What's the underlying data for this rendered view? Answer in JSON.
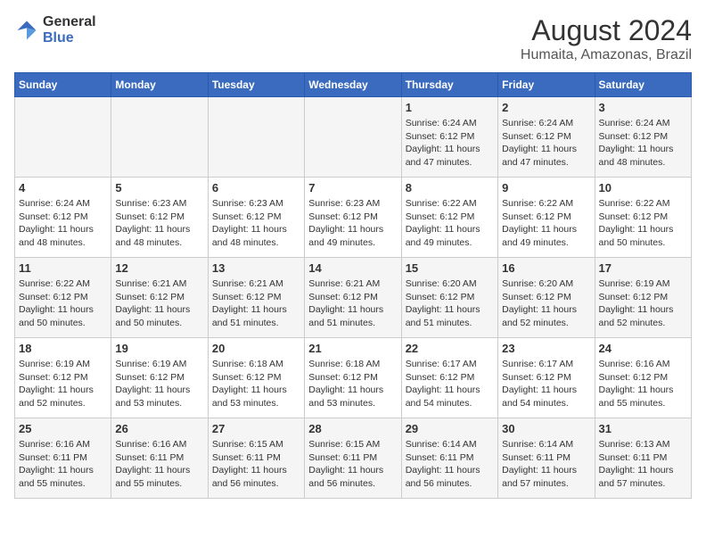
{
  "header": {
    "logo_line1": "General",
    "logo_line2": "Blue",
    "main_title": "August 2024",
    "sub_title": "Humaita, Amazonas, Brazil"
  },
  "weekdays": [
    "Sunday",
    "Monday",
    "Tuesday",
    "Wednesday",
    "Thursday",
    "Friday",
    "Saturday"
  ],
  "weeks": [
    [
      {
        "day": "",
        "info": ""
      },
      {
        "day": "",
        "info": ""
      },
      {
        "day": "",
        "info": ""
      },
      {
        "day": "",
        "info": ""
      },
      {
        "day": "1",
        "info": "Sunrise: 6:24 AM\nSunset: 6:12 PM\nDaylight: 11 hours\nand 47 minutes."
      },
      {
        "day": "2",
        "info": "Sunrise: 6:24 AM\nSunset: 6:12 PM\nDaylight: 11 hours\nand 47 minutes."
      },
      {
        "day": "3",
        "info": "Sunrise: 6:24 AM\nSunset: 6:12 PM\nDaylight: 11 hours\nand 48 minutes."
      }
    ],
    [
      {
        "day": "4",
        "info": "Sunrise: 6:24 AM\nSunset: 6:12 PM\nDaylight: 11 hours\nand 48 minutes."
      },
      {
        "day": "5",
        "info": "Sunrise: 6:23 AM\nSunset: 6:12 PM\nDaylight: 11 hours\nand 48 minutes."
      },
      {
        "day": "6",
        "info": "Sunrise: 6:23 AM\nSunset: 6:12 PM\nDaylight: 11 hours\nand 48 minutes."
      },
      {
        "day": "7",
        "info": "Sunrise: 6:23 AM\nSunset: 6:12 PM\nDaylight: 11 hours\nand 49 minutes."
      },
      {
        "day": "8",
        "info": "Sunrise: 6:22 AM\nSunset: 6:12 PM\nDaylight: 11 hours\nand 49 minutes."
      },
      {
        "day": "9",
        "info": "Sunrise: 6:22 AM\nSunset: 6:12 PM\nDaylight: 11 hours\nand 49 minutes."
      },
      {
        "day": "10",
        "info": "Sunrise: 6:22 AM\nSunset: 6:12 PM\nDaylight: 11 hours\nand 50 minutes."
      }
    ],
    [
      {
        "day": "11",
        "info": "Sunrise: 6:22 AM\nSunset: 6:12 PM\nDaylight: 11 hours\nand 50 minutes."
      },
      {
        "day": "12",
        "info": "Sunrise: 6:21 AM\nSunset: 6:12 PM\nDaylight: 11 hours\nand 50 minutes."
      },
      {
        "day": "13",
        "info": "Sunrise: 6:21 AM\nSunset: 6:12 PM\nDaylight: 11 hours\nand 51 minutes."
      },
      {
        "day": "14",
        "info": "Sunrise: 6:21 AM\nSunset: 6:12 PM\nDaylight: 11 hours\nand 51 minutes."
      },
      {
        "day": "15",
        "info": "Sunrise: 6:20 AM\nSunset: 6:12 PM\nDaylight: 11 hours\nand 51 minutes."
      },
      {
        "day": "16",
        "info": "Sunrise: 6:20 AM\nSunset: 6:12 PM\nDaylight: 11 hours\nand 52 minutes."
      },
      {
        "day": "17",
        "info": "Sunrise: 6:19 AM\nSunset: 6:12 PM\nDaylight: 11 hours\nand 52 minutes."
      }
    ],
    [
      {
        "day": "18",
        "info": "Sunrise: 6:19 AM\nSunset: 6:12 PM\nDaylight: 11 hours\nand 52 minutes."
      },
      {
        "day": "19",
        "info": "Sunrise: 6:19 AM\nSunset: 6:12 PM\nDaylight: 11 hours\nand 53 minutes."
      },
      {
        "day": "20",
        "info": "Sunrise: 6:18 AM\nSunset: 6:12 PM\nDaylight: 11 hours\nand 53 minutes."
      },
      {
        "day": "21",
        "info": "Sunrise: 6:18 AM\nSunset: 6:12 PM\nDaylight: 11 hours\nand 53 minutes."
      },
      {
        "day": "22",
        "info": "Sunrise: 6:17 AM\nSunset: 6:12 PM\nDaylight: 11 hours\nand 54 minutes."
      },
      {
        "day": "23",
        "info": "Sunrise: 6:17 AM\nSunset: 6:12 PM\nDaylight: 11 hours\nand 54 minutes."
      },
      {
        "day": "24",
        "info": "Sunrise: 6:16 AM\nSunset: 6:12 PM\nDaylight: 11 hours\nand 55 minutes."
      }
    ],
    [
      {
        "day": "25",
        "info": "Sunrise: 6:16 AM\nSunset: 6:11 PM\nDaylight: 11 hours\nand 55 minutes."
      },
      {
        "day": "26",
        "info": "Sunrise: 6:16 AM\nSunset: 6:11 PM\nDaylight: 11 hours\nand 55 minutes."
      },
      {
        "day": "27",
        "info": "Sunrise: 6:15 AM\nSunset: 6:11 PM\nDaylight: 11 hours\nand 56 minutes."
      },
      {
        "day": "28",
        "info": "Sunrise: 6:15 AM\nSunset: 6:11 PM\nDaylight: 11 hours\nand 56 minutes."
      },
      {
        "day": "29",
        "info": "Sunrise: 6:14 AM\nSunset: 6:11 PM\nDaylight: 11 hours\nand 56 minutes."
      },
      {
        "day": "30",
        "info": "Sunrise: 6:14 AM\nSunset: 6:11 PM\nDaylight: 11 hours\nand 57 minutes."
      },
      {
        "day": "31",
        "info": "Sunrise: 6:13 AM\nSunset: 6:11 PM\nDaylight: 11 hours\nand 57 minutes."
      }
    ]
  ]
}
